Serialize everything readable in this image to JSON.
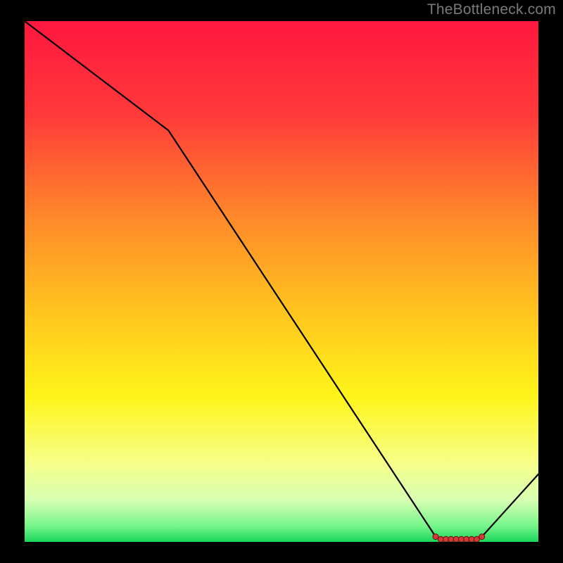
{
  "watermark": "TheBottleneck.com",
  "colors": {
    "frame": "#000000",
    "line": "#000000",
    "marker": "#d63a3a",
    "gradient_stops": [
      {
        "offset": 0.0,
        "color": "#ff173f"
      },
      {
        "offset": 0.18,
        "color": "#ff3a3a"
      },
      {
        "offset": 0.38,
        "color": "#ff8a2a"
      },
      {
        "offset": 0.55,
        "color": "#ffc21f"
      },
      {
        "offset": 0.72,
        "color": "#fff51a"
      },
      {
        "offset": 0.85,
        "color": "#f6ff8a"
      },
      {
        "offset": 0.92,
        "color": "#d7ffb3"
      },
      {
        "offset": 0.97,
        "color": "#75f58a"
      },
      {
        "offset": 1.0,
        "color": "#19d65a"
      }
    ]
  },
  "chart_data": {
    "type": "line",
    "title": "",
    "xlabel": "",
    "ylabel": "",
    "xlim": [
      0,
      100
    ],
    "ylim": [
      0,
      100
    ],
    "series": [
      {
        "name": "bottleneck-curve",
        "x": [
          0,
          28,
          80,
          81,
          82,
          83,
          84,
          85,
          86,
          87,
          88,
          89,
          100
        ],
        "y": [
          100,
          79,
          1,
          0.5,
          0.5,
          0.5,
          0.5,
          0.5,
          0.5,
          0.5,
          0.5,
          1,
          13
        ]
      }
    ],
    "markers": {
      "name": "flat-min-points",
      "x": [
        80,
        81,
        82,
        83,
        84,
        85,
        86,
        87,
        88,
        89
      ],
      "y": [
        1,
        0.5,
        0.5,
        0.5,
        0.5,
        0.5,
        0.5,
        0.5,
        0.5,
        1
      ]
    }
  }
}
